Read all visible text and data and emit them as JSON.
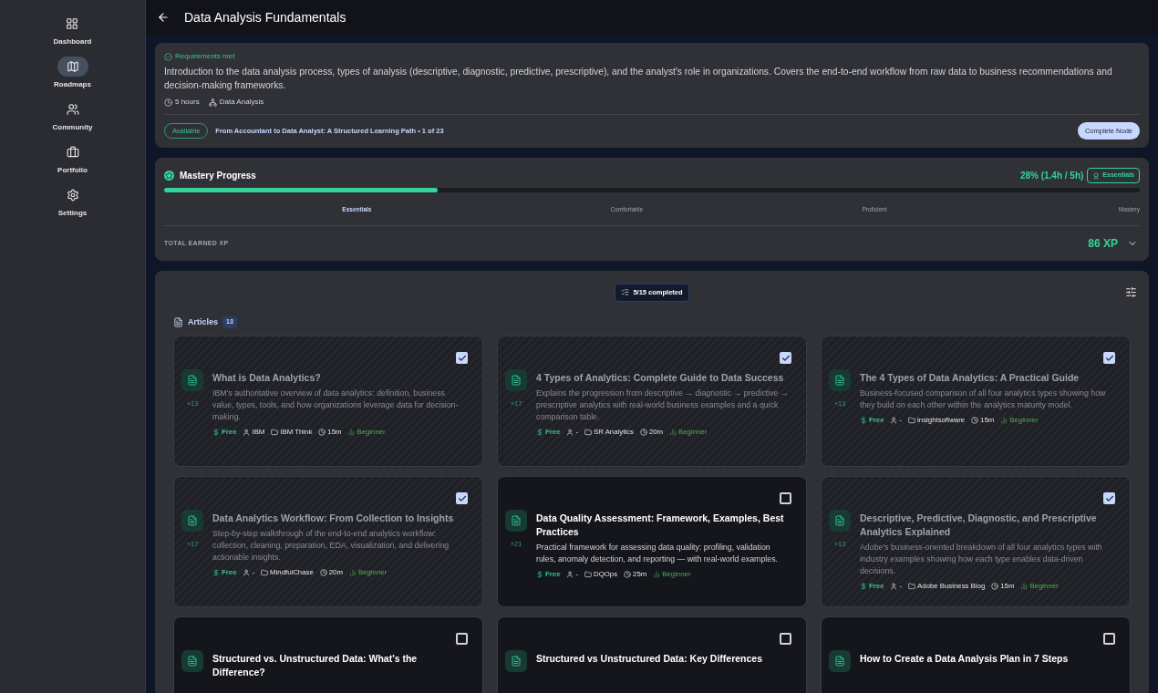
{
  "sidebar": {
    "items": [
      {
        "label": "Dashboard",
        "selected": false
      },
      {
        "label": "Roadmaps",
        "selected": true
      },
      {
        "label": "Community",
        "selected": false
      },
      {
        "label": "Portfolio",
        "selected": false
      },
      {
        "label": "Settings",
        "selected": false
      }
    ]
  },
  "header": {
    "title": "Data Analysis Fundamentals"
  },
  "overview": {
    "requirements": "Requirements met",
    "description": "Introduction to the data analysis process, types of analysis (descriptive, diagnostic, predictive, prescriptive), and the analyst's role in organizations. Covers the end-to-end workflow from raw data to business recommendations and decision-making frameworks.",
    "duration": "5 hours",
    "topic": "Data Analysis",
    "status": "Available",
    "path": "From Accountant to Data Analyst: A Structured Learning Path • 1 of 23",
    "action": "Complete Node"
  },
  "mastery": {
    "title": "Mastery Progress",
    "reading": "28% (1.4h / 5h)",
    "badge": "Essentials",
    "level": 0.28,
    "stages": [
      {
        "label": "Essentials",
        "selected": true
      },
      {
        "label": "Comfortable",
        "selected": false
      },
      {
        "label": "Proficient",
        "selected": false
      },
      {
        "label": "Mastery",
        "selected": false
      }
    ],
    "xp_label": "TOTAL EARNED XP",
    "xp": "86 XP"
  },
  "resources": {
    "completed": "5/15 completed",
    "section": "Articles",
    "count": "13",
    "cards": [
      {
        "title": "What is Data Analytics?",
        "xp": "+13",
        "description": "IBM's authoritative overview of data analytics: definition, business value, types, tools, and how organizations leverage data for decision-making.",
        "price": "Free",
        "author": "IBM",
        "source": "IBM Think",
        "time": "15m",
        "difficulty": "Beginner",
        "checked": true
      },
      {
        "title": "4 Types of Analytics: Complete Guide to Data Success",
        "xp": "+17",
        "description": "Explains the progression from descriptive → diagnostic → predictive → prescriptive analytics with real-world business examples and a quick comparison table.",
        "price": "Free",
        "author": "-",
        "source": "SR Analytics",
        "time": "20m",
        "difficulty": "Beginner",
        "checked": true
      },
      {
        "title": "The 4 Types of Data Analytics: A Practical Guide",
        "xp": "+13",
        "description": "Business-focused comparison of all four analytics types showing how they build on each other within the analytics maturity model.",
        "price": "Free",
        "author": "-",
        "source": "insightsoftware",
        "time": "15m",
        "difficulty": "Beginner",
        "checked": true
      },
      {
        "title": "Data Analytics Workflow: From Collection to Insights",
        "xp": "+17",
        "description": "Step-by-step walkthrough of the end-to-end analytics workflow: collection, cleaning, preparation, EDA, visualization, and delivering actionable insights.",
        "price": "Free",
        "author": "-",
        "source": "MindfulChase",
        "time": "20m",
        "difficulty": "Beginner",
        "checked": true
      },
      {
        "title": "Data Quality Assessment: Framework, Examples, Best Practices",
        "xp": "+21",
        "description": "Practical framework for assessing data quality: profiling, validation rules, anomaly detection, and reporting — with real-world examples.",
        "price": "Free",
        "author": "-",
        "source": "DQOps",
        "time": "25m",
        "difficulty": "Beginner",
        "checked": false
      },
      {
        "title": "Descriptive, Predictive, Diagnostic, and Prescriptive Analytics Explained",
        "xp": "+13",
        "description": "Adobe's business-oriented breakdown of all four analytics types with industry examples showing how each type enables data-driven decisions.",
        "price": "Free",
        "author": "-",
        "source": "Adobe Business Blog",
        "time": "15m",
        "difficulty": "Beginner",
        "checked": true
      },
      {
        "title": "Structured vs. Unstructured Data: What's the Difference?",
        "checked": false
      },
      {
        "title": "Structured vs Unstructured Data: Key Differences",
        "checked": false
      },
      {
        "title": "How to Create a Data Analysis Plan in 7 Steps",
        "checked": false
      }
    ]
  }
}
